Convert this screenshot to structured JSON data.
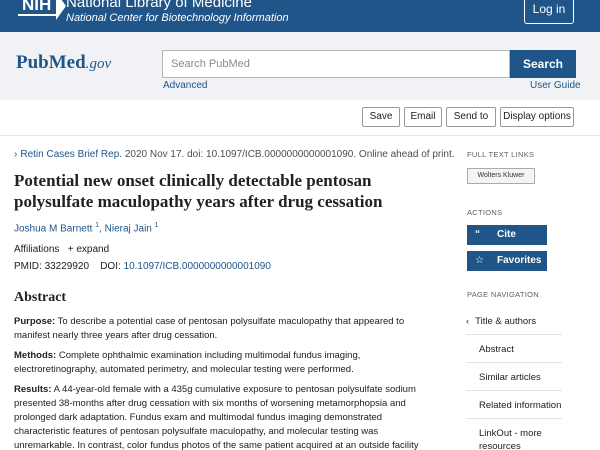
{
  "nih_banner": {
    "logo_text": "NIH",
    "title": "National Library of Medicine",
    "subtitle": "National Center for Biotechnology Information",
    "login_label": "Log in"
  },
  "search": {
    "logo_main": "PubMed",
    "logo_suffix": ".gov",
    "placeholder": "Search PubMed",
    "button_label": "Search",
    "advanced_label": "Advanced",
    "user_guide_label": "User Guide"
  },
  "toolbar": {
    "save_label": "Save",
    "email_label": "Email",
    "send_to_label": "Send to",
    "display_options_label": "Display options"
  },
  "article": {
    "journal": "Retin Cases Brief Rep.",
    "citation": "2020 Nov 17. doi: 10.1097/ICB.0000000000001090. Online ahead of print.",
    "title": "Potential new onset clinically detectable pentosan polysulfate maculopathy years after drug cessation",
    "authors": [
      {
        "name": "Joshua M Barnett",
        "sup": "1"
      },
      {
        "name": "Nieraj Jain",
        "sup": "1"
      }
    ],
    "author_sep": ",",
    "affiliations_label": "Affiliations",
    "expand_label": "+ expand",
    "pmid_label": "PMID:",
    "pmid": "33229920",
    "doi_label": "DOI:",
    "doi": "10.1097/ICB.0000000000001090"
  },
  "abstract": {
    "heading": "Abstract",
    "purpose_label": "Purpose:",
    "purpose": "To describe a potential case of pentosan polysulfate maculopathy that appeared to manifest nearly three years after drug cessation.",
    "methods_label": "Methods:",
    "methods": "Complete ophthalmic examination including multimodal fundus imaging, electroretinography, automated perimetry, and molecular testing were performed.",
    "results_label": "Results:",
    "results": "A 44-year-old female with a 435g cumulative exposure to pentosan polysulfate sodium presented 38-months after drug cessation with six months of worsening metamorphopsia and prolonged dark adaptation. Fundus exam and multimodal fundus imaging demonstrated characteristic features of pentosan polysulfate maculopathy, and molecular testing was unremarkable. In contrast, color fundus photos of the same patient acquired at an outside facility"
  },
  "sidebar": {
    "full_text_heading": "FULL TEXT LINKS",
    "publisher_label": "Wolters Kluwer",
    "actions_heading": "ACTIONS",
    "cite_label": "Cite",
    "favorites_label": "Favorites",
    "page_nav_heading": "PAGE NAVIGATION",
    "nav_items": [
      {
        "label": "Title & authors"
      },
      {
        "label": "Abstract"
      },
      {
        "label": "Similar articles"
      },
      {
        "label": "Related information"
      },
      {
        "label": "LinkOut - more resources"
      }
    ]
  },
  "colors": {
    "brand_blue": "#20558a",
    "search_band": "#f0f2f5"
  }
}
